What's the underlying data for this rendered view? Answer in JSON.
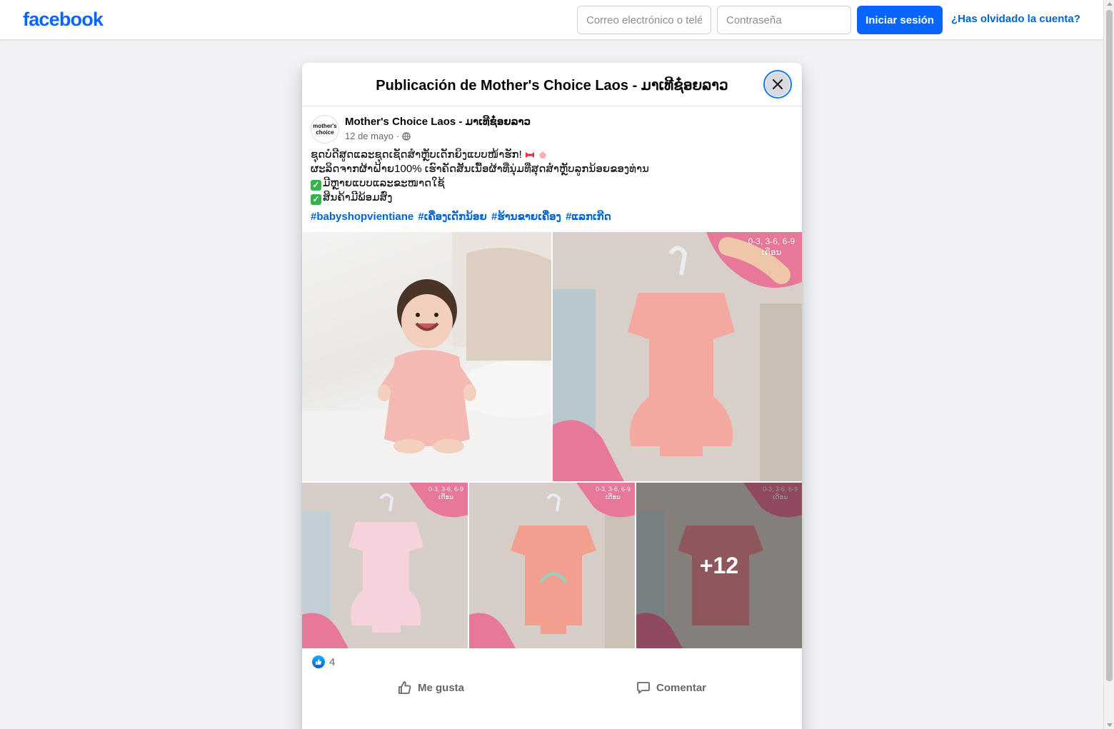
{
  "topbar": {
    "logo": "facebook",
    "email_placeholder": "Correo electrónico o teléfono",
    "password_placeholder": "Contraseña",
    "login_label": "Iniciar sesión",
    "forgot_label": "¿Has olvidado la cuenta?",
    "brand_color": "#0866ff"
  },
  "dialog": {
    "title": "Publicación de Mother's Choice Laos - ມາເທີຊ໋ອຍລາວ",
    "close_icon": "close-icon"
  },
  "post": {
    "avatar_text": "mother's choice",
    "page_name": "Mother's Choice Laos - ມາເທີຊ໋ອຍລາວ",
    "date": "12 de mayo",
    "separator": "·",
    "privacy_icon": "globe-icon",
    "text_lines": [
      "ຊຸດບໍດີສູດແລະຊຸດເຊັດສຳຫຼັບເດັກຍິງແບບໜ້າຮັກ!",
      "ຜະລິດຈາກຜ້າຝ້າຍ100% ເຮົາຄັດສັນເນື້ອຜ້າທີ່ນຸ່ມທີ່ສຸດສຳຫຼັບລູກນ້ອຍຂອງທ່ານ",
      "ມີຫຼາຍແບບແລະຂະໜາດໃຊ້",
      "ສິນຄ້າມີພ້ອມສົ່ງ"
    ],
    "hashtags": [
      "#babyshopvientiane",
      "#ເຄື່ອງເດັກນ້ອຍ",
      "#ຮ້ານຂາຍເຄື່ອງ",
      "#ແລກເກີດ"
    ],
    "size_label_line1": "0-3, 3-6, 6-9",
    "size_label_line2": "ເດືອນ",
    "more_photos": "+12",
    "reaction_count": "4",
    "like_label": "Me gusta",
    "comment_label": "Comentar"
  }
}
